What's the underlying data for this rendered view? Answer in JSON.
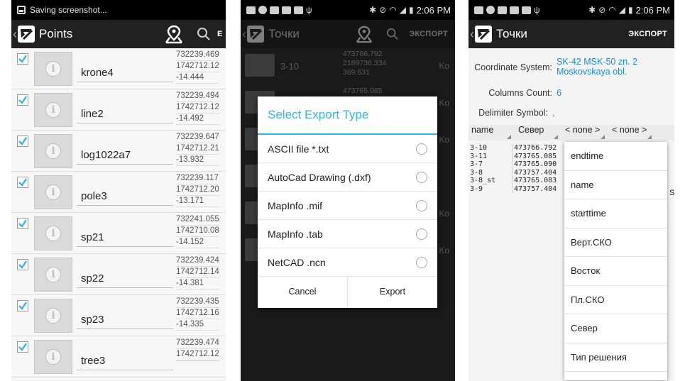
{
  "screen1": {
    "status": "Saving screenshot...",
    "title": "Points",
    "rows": [
      {
        "name": "krone4",
        "vals": [
          "732239.469",
          "1742712.12",
          "-14.444"
        ]
      },
      {
        "name": "line2",
        "vals": [
          "732239.494",
          "1742712.12",
          "-14.492"
        ]
      },
      {
        "name": "log1022a7",
        "vals": [
          "732239.647",
          "1742712.21",
          "-13.932"
        ]
      },
      {
        "name": "pole3",
        "vals": [
          "732239.117",
          "1742712.20",
          "-13.171"
        ]
      },
      {
        "name": "sp21",
        "vals": [
          "732241.055",
          "1742710.08",
          "-14.152"
        ]
      },
      {
        "name": "sp22",
        "vals": [
          "732239.424",
          "1742712.14",
          "-14.381"
        ]
      },
      {
        "name": "sp23",
        "vals": [
          "732239.435",
          "1742712.16",
          "-14.335"
        ]
      },
      {
        "name": "tree3",
        "vals": [
          "732239.474",
          "1742712.12",
          ""
        ]
      }
    ],
    "accent": "#33b5e5"
  },
  "screen2": {
    "time": "2:06 PM",
    "title": "Точки",
    "action": "ЭКСПОРТ",
    "bg_rows": [
      {
        "name": "3-10",
        "vals": [
          "473766.792",
          "2189736.334",
          "369.631"
        ],
        "ko": "Ko"
      },
      {
        "name": "",
        "vals": [
          "473765.085",
          "",
          ""
        ],
        "ko": "Ko"
      },
      {
        "name": "",
        "vals": [
          "",
          "",
          ""
        ],
        "ko": "Ko"
      },
      {
        "name": "",
        "vals": [
          "",
          "",
          ""
        ],
        "ko": ""
      },
      {
        "name": "",
        "vals": [
          "",
          "",
          ""
        ],
        "ko": "Ko"
      },
      {
        "name": "",
        "vals": [
          "",
          "",
          ""
        ],
        "ko": "Ko"
      }
    ],
    "dialog": {
      "title": "Select Export Type",
      "options": [
        "ASCII file *.txt",
        "AutoCad Drawing (.dxf)",
        "MapInfo .mif",
        "MapInfo .tab",
        "NetCAD .ncn"
      ],
      "cancel": "Cancel",
      "export": "Export"
    }
  },
  "screen3": {
    "time": "2:06 PM",
    "title": "Точки",
    "action": "ЭКСПОРТ",
    "coord_label": "Coordinate System:",
    "coord_value": "SK-42 MSK-50 zn. 2 Moskovskaya obl.",
    "count_label": "Columns Count:",
    "count_value": "6",
    "delim_label": "Delimiter Symbol:",
    "delim_value": ",",
    "columns": [
      "name",
      "Север",
      "< none >",
      "< none >"
    ],
    "grid": [
      [
        "3-10",
        "473766.792"
      ],
      [
        "3-11",
        "473765.085"
      ],
      [
        "3-7",
        "473765.090"
      ],
      [
        "3-8",
        "473757.404"
      ],
      [
        "3-8_st",
        "473765.083"
      ],
      [
        "3-9",
        "473757.404"
      ]
    ],
    "extra_char": "S",
    "popup": [
      "endtime",
      "name",
      "starttime",
      "Верт.СКО",
      "Восток",
      "Пл.СКО",
      "Север",
      "Тип решения"
    ]
  }
}
